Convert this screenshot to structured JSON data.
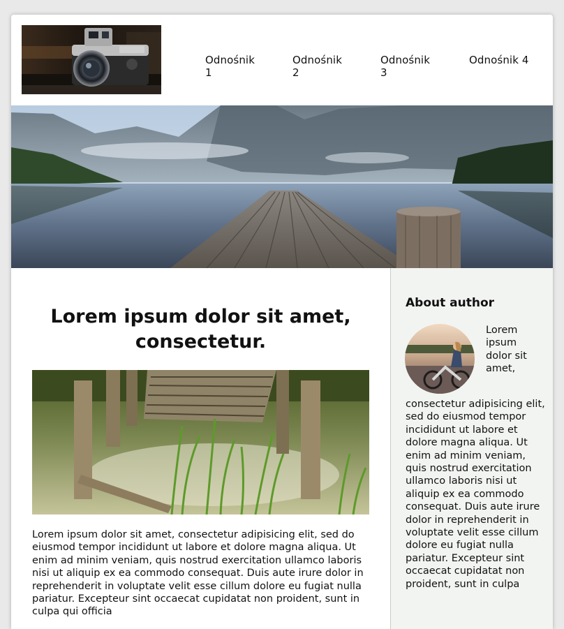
{
  "nav": {
    "items": [
      "Odnośnik 1",
      "Odnośnik 2",
      "Odnośnik 3",
      "Odnośnik 4"
    ]
  },
  "images": {
    "logo": "camera-photo",
    "hero": "mountain-lake-pier-photo",
    "article": "broken-wooden-pier-photo",
    "avatar": "woman-on-bicycle-photo"
  },
  "article": {
    "title": "Lorem ipsum dolor sit amet, consectetur.",
    "text": "Lorem ipsum dolor sit amet, consectetur adipisicing elit, sed do eiusmod tempor incididunt ut labore et dolore magna aliqua. Ut enim ad minim veniam, quis nostrud exercitation ullamco laboris nisi ut aliquip ex ea commodo consequat. Duis aute irure dolor in reprehenderit in voluptate velit esse cillum dolore eu fugiat nulla pariatur. Excepteur sint occaecat cupidatat non proident, sunt in culpa qui officia"
  },
  "sidebar": {
    "title": "About author",
    "text_short": "Lorem ipsum dolor sit amet,",
    "text_long": "consectetur adipisicing elit, sed do eiusmod tempor incididunt ut labore et dolore magna aliqua. Ut enim ad minim veniam, quis nostrud exercitation ullamco laboris nisi ut aliquip ex ea commodo consequat. Duis aute irure dolor in reprehenderit in voluptate velit esse cillum dolore eu fugiat nulla pariatur. Excepteur sint occaecat cupidatat non proident, sunt in culpa"
  },
  "colors": {
    "sidebar_bg": "#f2f4f1",
    "page_bg": "#e9e9e9"
  }
}
